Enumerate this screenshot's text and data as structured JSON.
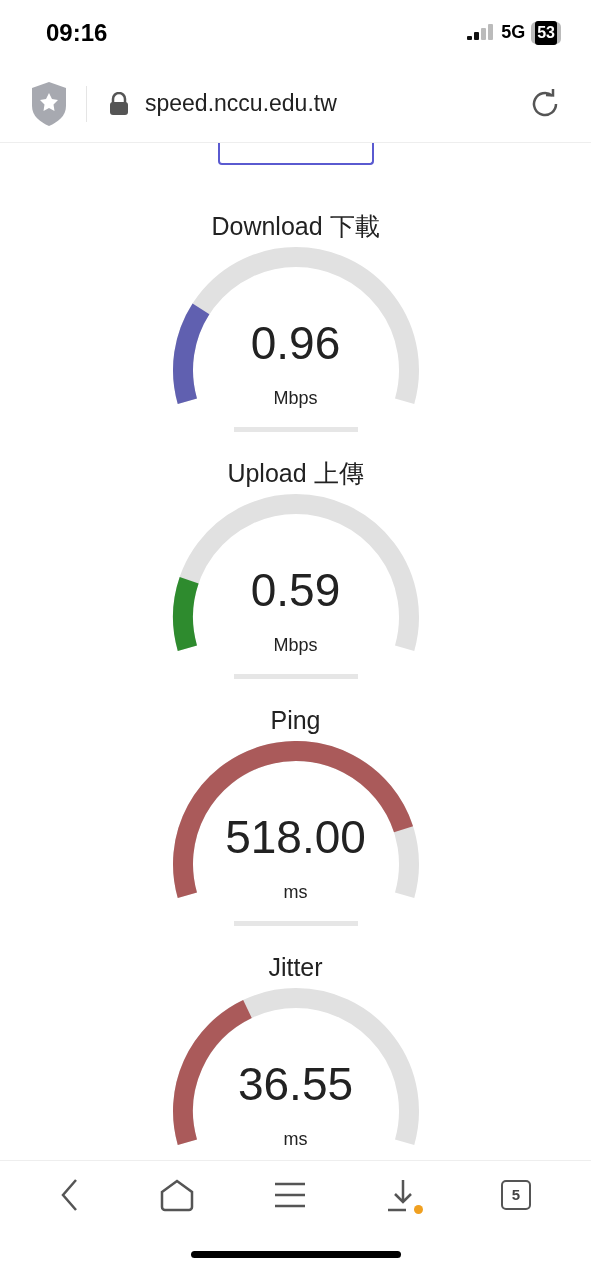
{
  "status_bar": {
    "time": "09:16",
    "network": "5G",
    "battery": "53"
  },
  "address_bar": {
    "url": "speed.nccu.edu.tw"
  },
  "gauges": [
    {
      "title": "Download 下載",
      "value": "0.96",
      "unit": "Mbps",
      "color": "#6060b0"
    },
    {
      "title": "Upload 上傳",
      "value": "0.59",
      "unit": "Mbps",
      "color": "#2e8b2e"
    },
    {
      "title": "Ping",
      "value": "518.00",
      "unit": "ms",
      "color": "#aa5a5a"
    },
    {
      "title": "Jitter",
      "value": "36.55",
      "unit": "ms",
      "color": "#aa5a5a"
    }
  ],
  "toolbar": {
    "tab_count": "5",
    "download_notification": true
  }
}
